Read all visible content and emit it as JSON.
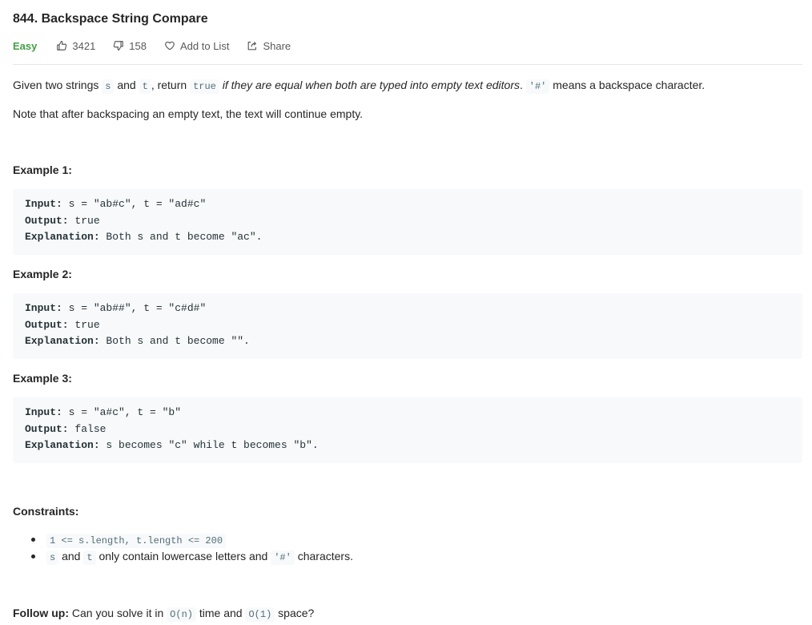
{
  "problem": {
    "title": "844. Backspace String Compare",
    "difficulty": "Easy",
    "likes": "3421",
    "dislikes": "158",
    "add_to_list": "Add to List",
    "share": "Share"
  },
  "description": {
    "p1_given": "Given two strings",
    "p1_s": "s",
    "p1_and": "and",
    "p1_t": "t",
    "p1_return": ", return",
    "p1_true": "true",
    "p1_italic": "if they are equal when both are typed into empty text editors",
    "p1_period": ".",
    "p1_hash": "'#'",
    "p1_end": "means a backspace character.",
    "p2": "Note that after backspacing an empty text, the text will continue empty."
  },
  "examples": [
    {
      "title": "Example 1:",
      "input_label": "Input:",
      "input": " s = \"ab#c\", t = \"ad#c\"",
      "output_label": "Output:",
      "output": " true",
      "explanation_label": "Explanation:",
      "explanation": " Both s and t become \"ac\"."
    },
    {
      "title": "Example 2:",
      "input_label": "Input:",
      "input": " s = \"ab##\", t = \"c#d#\"",
      "output_label": "Output:",
      "output": " true",
      "explanation_label": "Explanation:",
      "explanation": " Both s and t become \"\"."
    },
    {
      "title": "Example 3:",
      "input_label": "Input:",
      "input": " s = \"a#c\", t = \"b\"",
      "output_label": "Output:",
      "output": " false",
      "explanation_label": "Explanation:",
      "explanation": " s becomes \"c\" while t becomes \"b\"."
    }
  ],
  "constraints": {
    "title": "Constraints:",
    "c1_code": "1 <= s.length, t.length <= 200",
    "c2_s": "s",
    "c2_and": "and",
    "c2_t": "t",
    "c2_mid": "only contain lowercase letters and",
    "c2_hash": "'#'",
    "c2_end": "characters."
  },
  "followup": {
    "label": "Follow up:",
    "text1": "Can you solve it in",
    "on": "O(n)",
    "text2": "time and",
    "o1": "O(1)",
    "text3": "space?"
  },
  "colors": {
    "easy": "#43a047",
    "code_bg": "#f7f9fa"
  }
}
